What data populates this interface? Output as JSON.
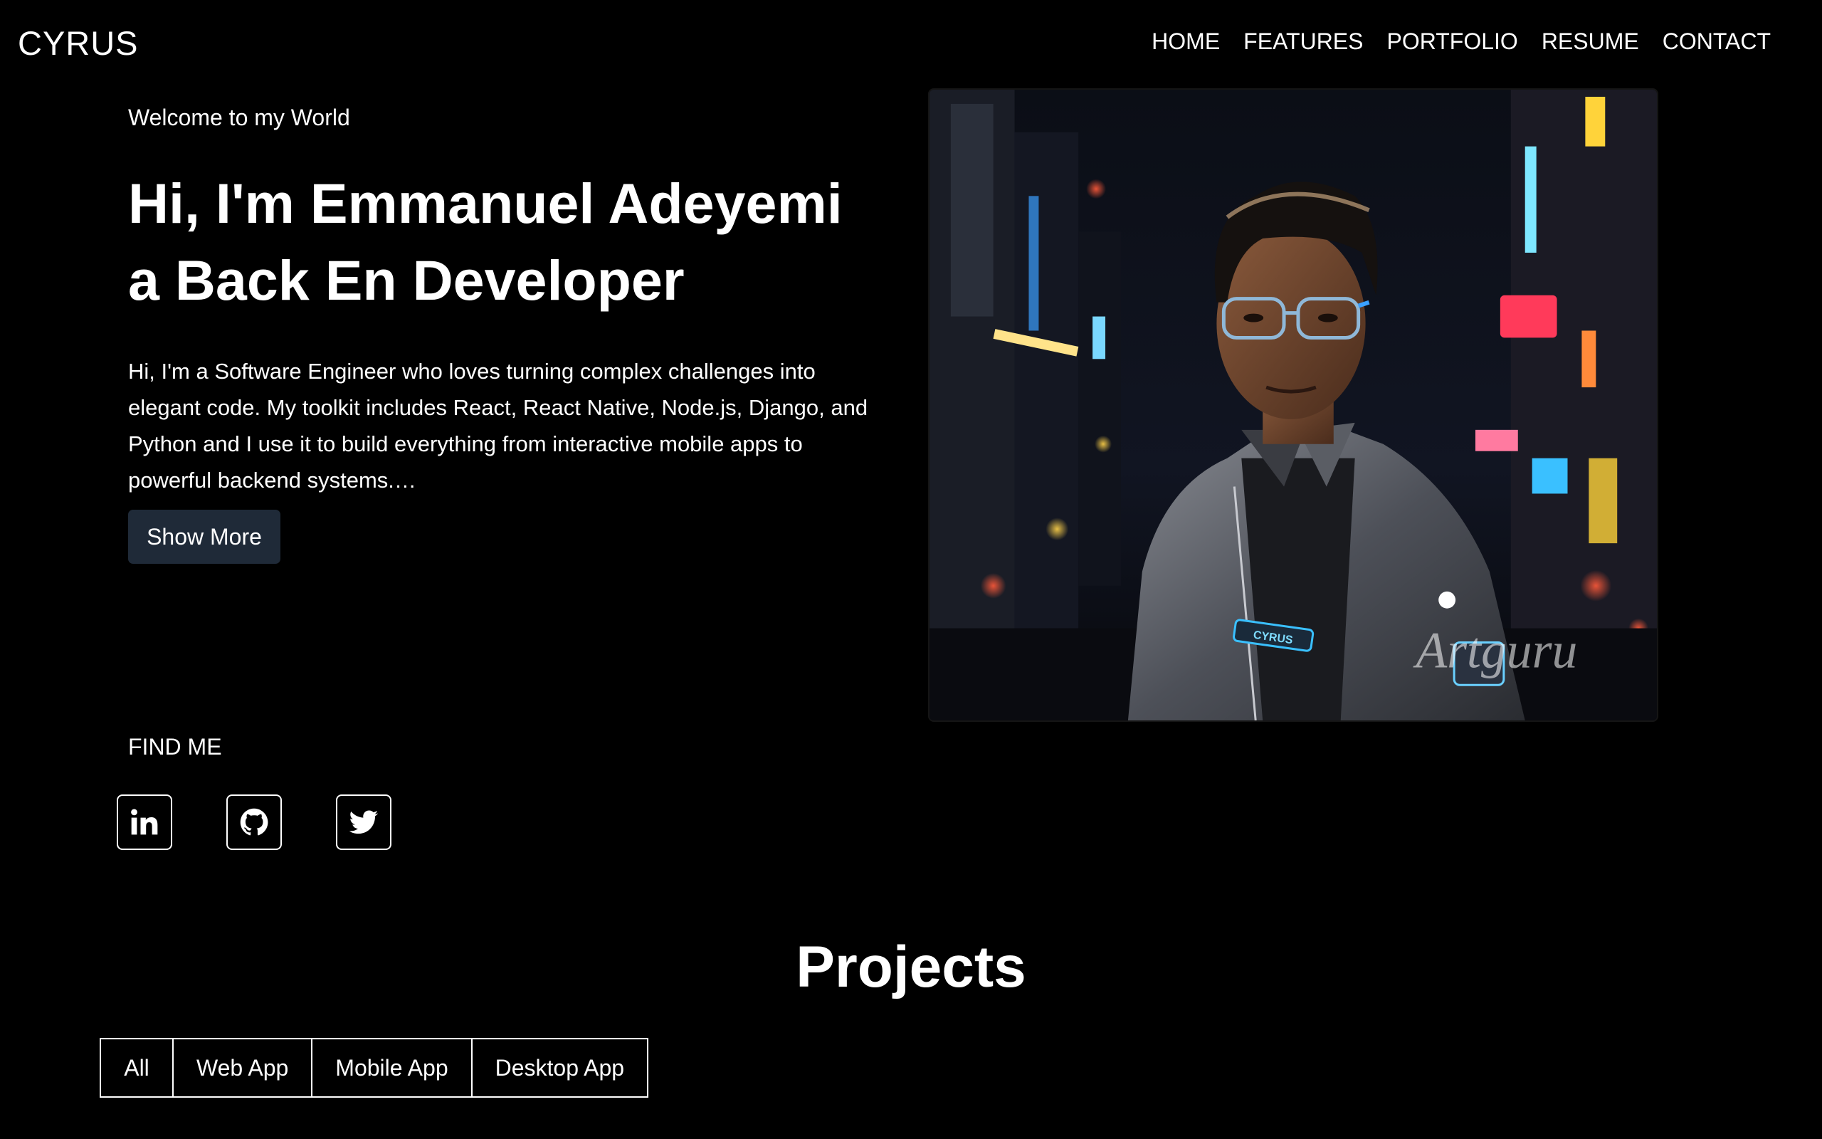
{
  "header": {
    "brand": "CYRUS",
    "nav": [
      "HOME",
      "FEATURES",
      "PORTFOLIO",
      "RESUME",
      "CONTACT"
    ]
  },
  "hero": {
    "welcome": "Welcome to my World",
    "headline_line1": "Hi, I'm Emmanuel Adeyemi",
    "headline_line2": "a Back En Developer",
    "bio": "Hi, I'm a Software Engineer who loves turning complex challenges into elegant code. My toolkit includes React, React Native, Node.js, Django, and Python and I use it to build everything from interactive mobile apps to powerful backend systems.…",
    "show_more_label": "Show More",
    "image_watermark": "Artguru",
    "jacket_patch": "CYRUS"
  },
  "find_me": {
    "label": "FIND ME",
    "socials": [
      {
        "icon": "linkedin-icon"
      },
      {
        "icon": "github-icon"
      },
      {
        "icon": "twitter-icon"
      }
    ]
  },
  "projects": {
    "title": "Projects",
    "filters": [
      "All",
      "Web App",
      "Mobile App",
      "Desktop App"
    ]
  },
  "colors": {
    "background": "#000000",
    "text": "#ffffff",
    "button": "#1f2a38"
  }
}
